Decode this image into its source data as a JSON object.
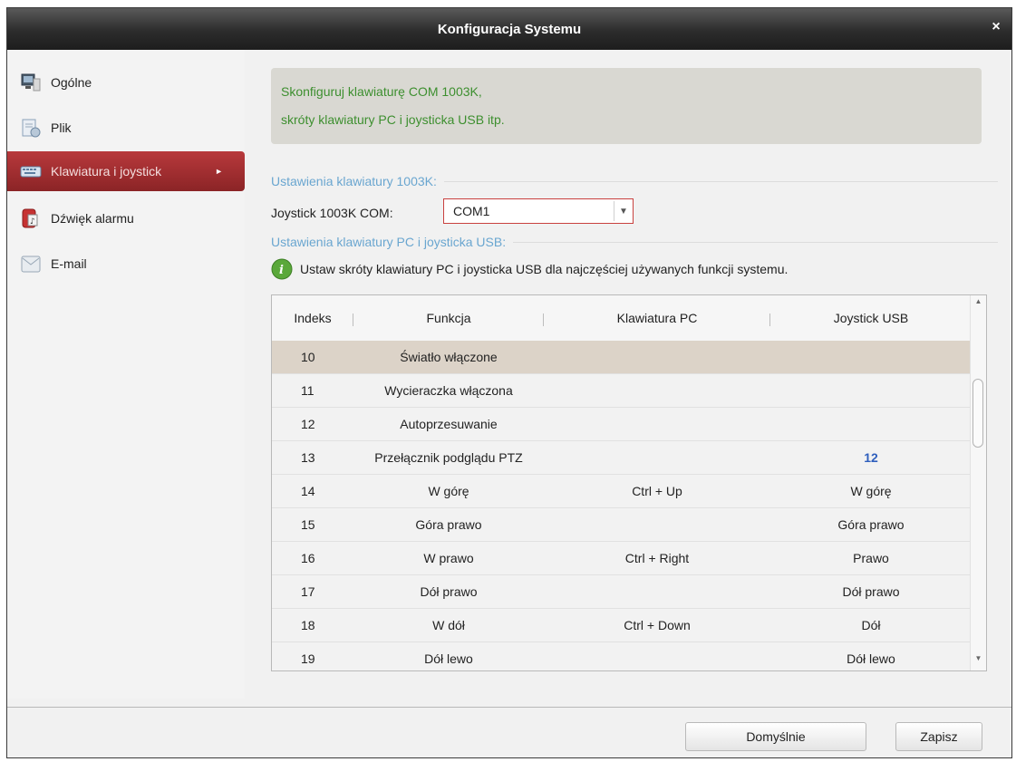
{
  "window": {
    "title": "Konfiguracja Systemu",
    "close_label": "×"
  },
  "sidebar": {
    "items": [
      {
        "label": "Ogólne",
        "icon": "monitor-icon"
      },
      {
        "label": "Plik",
        "icon": "file-icon"
      },
      {
        "label": "Klawiatura i joystick",
        "icon": "keyboard-icon",
        "active": true
      },
      {
        "label": "Dźwięk alarmu",
        "icon": "alarm-sound-icon"
      },
      {
        "label": "E-mail",
        "icon": "email-icon"
      }
    ],
    "active_arrow": "►"
  },
  "main": {
    "info_line1": "Skonfiguruj klawiaturę COM 1003K,",
    "info_line2": "skróty klawiatury PC i joysticka USB itp.",
    "section1": "Ustawienia klawiatury 1003K:",
    "com_label": "Joystick 1003K COM:",
    "com_value": "COM1",
    "section2": "Ustawienia klawiatury PC i joysticka USB:",
    "hint": "Ustaw skróty klawiatury PC i joysticka USB dla najczęściej używanych funkcji systemu.",
    "table": {
      "headers": [
        "Indeks",
        "Funkcja",
        "Klawiatura PC",
        "Joystick USB"
      ],
      "rows": [
        {
          "index": "10",
          "function": "Światło włączone",
          "pc": "",
          "usb": ""
        },
        {
          "index": "11",
          "function": "Wycieraczka włączona",
          "pc": "",
          "usb": ""
        },
        {
          "index": "12",
          "function": "Autoprzesuwanie",
          "pc": "",
          "usb": ""
        },
        {
          "index": "13",
          "function": "Przełącznik podglądu PTZ",
          "pc": "",
          "usb": "12"
        },
        {
          "index": "14",
          "function": "W górę",
          "pc": "Ctrl + Up",
          "usb": "W górę"
        },
        {
          "index": "15",
          "function": "Góra prawo",
          "pc": "",
          "usb": "Góra prawo"
        },
        {
          "index": "16",
          "function": "W prawo",
          "pc": "Ctrl + Right",
          "usb": "Prawo"
        },
        {
          "index": "17",
          "function": "Dół prawo",
          "pc": "",
          "usb": "Dół prawo"
        },
        {
          "index": "18",
          "function": "W dół",
          "pc": "Ctrl + Down",
          "usb": "Dół"
        },
        {
          "index": "19",
          "function": "Dół lewo",
          "pc": "",
          "usb": "Dół lewo"
        }
      ]
    }
  },
  "footer": {
    "default_label": "Domyślnie",
    "save_label": "Zapisz"
  },
  "colors": {
    "accent": "#a83033",
    "info_text": "#3d8f2f",
    "section_text": "#6aa6d0",
    "highlight": "#2f5fbd"
  }
}
